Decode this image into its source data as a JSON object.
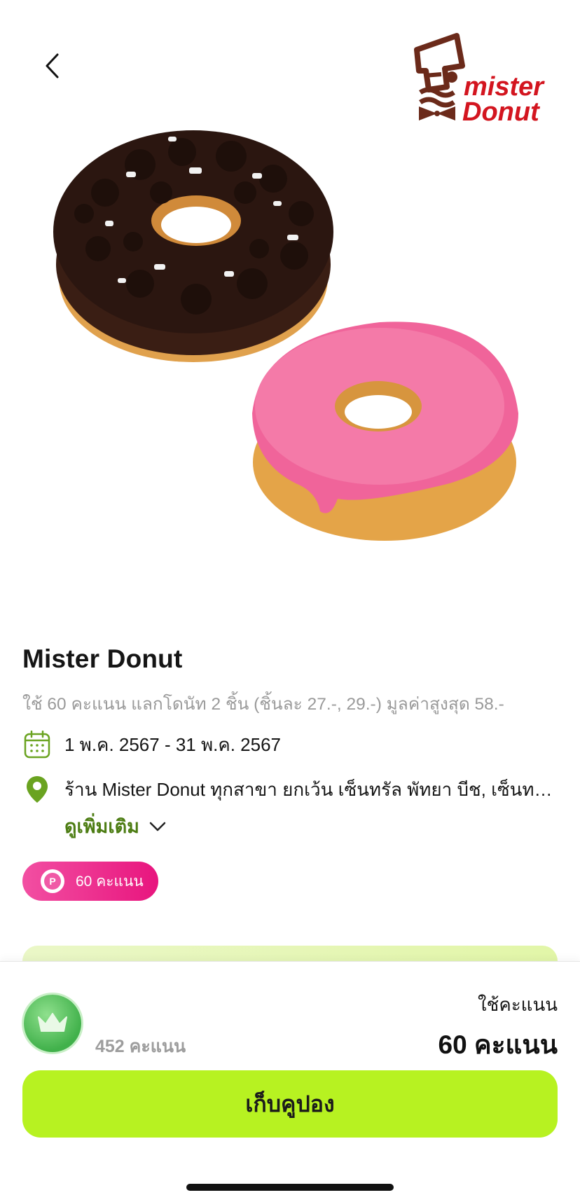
{
  "header": {
    "back_icon": "chevron-left-icon",
    "logo_text_line1": "mister",
    "logo_text_line2": "Donut"
  },
  "offer": {
    "title": "Mister Donut",
    "description": "ใช้ 60 คะแนน แลกโดนัท 2 ชิ้น (ชิ้นละ 27.-, 29.-) มูลค่าสูงสุด 58.-",
    "date_range": "1 พ.ค. 2567 - 31 พ.ค. 2567",
    "location": "ร้าน Mister Donut ทุกสาขา ยกเว้น เซ็นทรัล พัทยา บีช, เซ็นทรัล...",
    "see_more": "ดูเพิ่มเติม",
    "points_badge_letter": "P",
    "points_badge": "60 คะแนน"
  },
  "footer": {
    "user_points": "452 คะแนน",
    "use_label": "ใช้คะแนน",
    "use_value": "60 คะแนน",
    "cta_label": "เก็บคูปอง"
  },
  "colors": {
    "accent_green": "#b7f221",
    "link_green": "#4d7d14",
    "pink": "#e8157e",
    "brand_red": "#d3151f",
    "brand_brown": "#6b2a1a"
  }
}
